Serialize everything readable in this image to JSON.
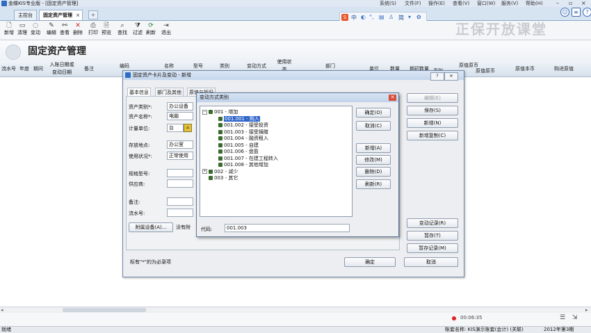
{
  "app": {
    "title": "金蝶KIS专业版 - [固定资产管理]",
    "menus": [
      "系统(S)",
      "文件(F)",
      "操作(E)",
      "查看(V)",
      "窗口(W)",
      "服务(V)",
      "帮助(H)"
    ],
    "window_controls": [
      "–",
      "▫",
      "×"
    ]
  },
  "tabs": [
    "主控台",
    "固定资产管理"
  ],
  "ime": {
    "chars": [
      "中",
      "简"
    ]
  },
  "watermark": "正保开放课堂",
  "toolbar": [
    "新增",
    "清理",
    "变动",
    "编辑",
    "查看",
    "删除",
    "打印",
    "预览",
    "查找",
    "过滤",
    "刷新",
    "退出"
  ],
  "module_title": "固定资产管理",
  "table": {
    "headers": [
      "流水号",
      "年度",
      "期间",
      "入账日期或\n变动日期",
      "备注",
      "编码",
      "名称",
      "型号",
      "类别",
      "变动方式",
      "使用状\n态",
      "部门",
      "单位",
      "数量",
      "期初数量",
      "原值原币",
      "原值本币",
      "购进原值"
    ],
    "sub_headers": [
      "币别",
      "原值原币"
    ]
  },
  "card_dialog": {
    "title": "固定资产卡片及变动 - 新增",
    "tabs": [
      "基本信息",
      "部门及其他",
      "原值与折旧"
    ],
    "labels": {
      "category": "资产类别*:",
      "name": "资产名称*:",
      "unit": "计量单位:",
      "location": "存放地点:",
      "status": "使用状况*:",
      "model": "规格型号:",
      "supplier": "供应商:",
      "memo": "备注:",
      "serial": "流水号:"
    },
    "values": {
      "category": "办公设备",
      "name": "电脑",
      "unit": "台",
      "location": "办公室",
      "status": "正常使用"
    },
    "attach_button": "附属设备(A)...",
    "no_attach_text": "没有附",
    "required_note": "标有\"*\"的为必录项",
    "right_buttons": [
      "编辑(E)",
      "保存(S)",
      "新增(N)",
      "新增复制(C)"
    ],
    "right_buttons_lower": [
      "变动记录(R)",
      "暂存(T)",
      "暂存记录(M)"
    ],
    "ok": "确定",
    "cancel": "取消"
  },
  "change_dialog": {
    "title": "变动方式类别",
    "tree": [
      {
        "text": "001 - 增加",
        "level": 0,
        "expand": "−"
      },
      {
        "text": "001.001 - 购入",
        "level": 1,
        "selected": true
      },
      {
        "text": "001.002 - 接受投资",
        "level": 1
      },
      {
        "text": "001.003 - 接受捐赠",
        "level": 1
      },
      {
        "text": "001.004 - 融资租入",
        "level": 1
      },
      {
        "text": "001.005 - 自建",
        "level": 1
      },
      {
        "text": "001.006 - 盘盈",
        "level": 1
      },
      {
        "text": "001.007 - 在建工程转入",
        "level": 1
      },
      {
        "text": "001.008 - 其他增加",
        "level": 1
      },
      {
        "text": "002 - 减少",
        "level": 0,
        "expand": "+"
      },
      {
        "text": "003 - 其它",
        "level": 0
      }
    ],
    "buttons_top": [
      "确定(O)",
      "取消(C)"
    ],
    "buttons_mid": [
      "新增(A)",
      "修改(M)",
      "删除(D)",
      "刷新(R)"
    ],
    "code_label": "代码:",
    "code_value": "001.003"
  },
  "recording": {
    "time": "00:06:35"
  },
  "status": {
    "left": "就绪",
    "right": "账套名称: KIS演示账套(会计) (关联)",
    "period": "2012年第3期"
  },
  "colors": {
    "accent": "#2d64c8",
    "caption": "#c4d6ec",
    "close": "#d84c3a"
  }
}
